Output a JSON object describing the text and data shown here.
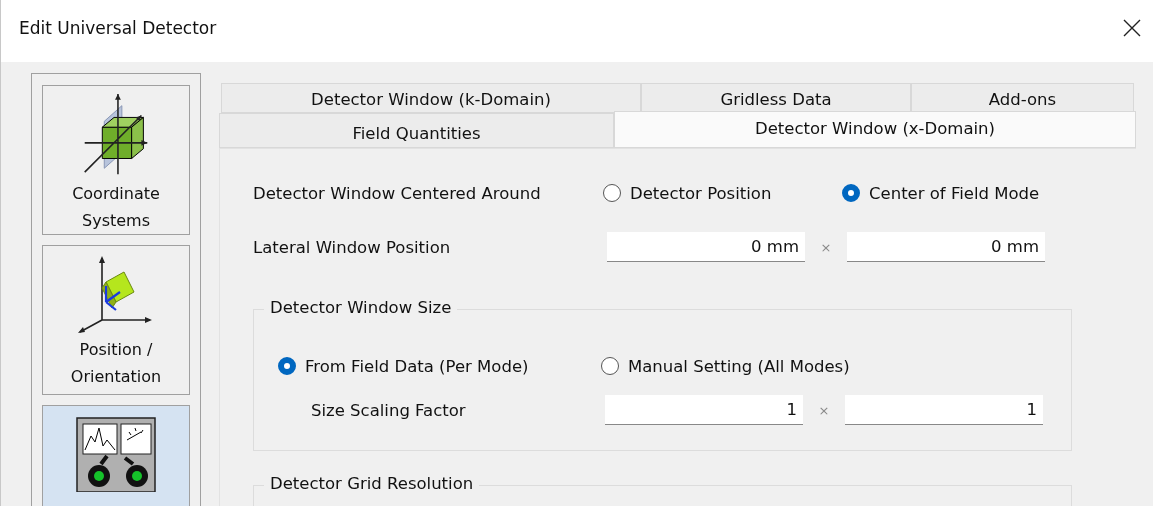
{
  "window": {
    "title": "Edit Universal Detector"
  },
  "sidebar": {
    "items": [
      {
        "kind": "coordinate",
        "label": "Coordinate Systems",
        "selected": false
      },
      {
        "kind": "position",
        "label": "Position / Orientation",
        "selected": false
      },
      {
        "kind": "instrument",
        "selected": true
      }
    ]
  },
  "tabs": {
    "rows": [
      [
        {
          "label": "Detector Window (k-Domain)",
          "selected": false
        },
        {
          "label": "Gridless Data",
          "selected": false
        },
        {
          "label": "Add-ons",
          "selected": false
        }
      ],
      [
        {
          "label": "Field Quantities",
          "selected": false
        },
        {
          "label": "Detector Window (x-Domain)",
          "selected": true
        }
      ]
    ]
  },
  "panel": {
    "rows": [
      {
        "kind": "radio",
        "label": "Detector Window Centered Around",
        "options": [
          {
            "label": "Detector Position",
            "selected": false
          },
          {
            "label": "Center of Field Mode",
            "selected": true
          }
        ]
      },
      {
        "kind": "pair",
        "label": "Lateral Window Position",
        "values": [
          "0 mm",
          "0 mm"
        ],
        "separator": "×"
      }
    ],
    "groups": [
      {
        "title": "Detector Window Size",
        "rows": [
          {
            "kind": "radio",
            "options": [
              {
                "label": "From Field Data (Per Mode)",
                "selected": true
              },
              {
                "label": "Manual Setting (All Modes)",
                "selected": false
              }
            ]
          },
          {
            "kind": "pair",
            "label": "Size Scaling Factor",
            "values": [
              "1",
              "1"
            ],
            "separator": "×"
          }
        ]
      },
      {
        "title": "Detector Grid Resolution"
      }
    ]
  }
}
